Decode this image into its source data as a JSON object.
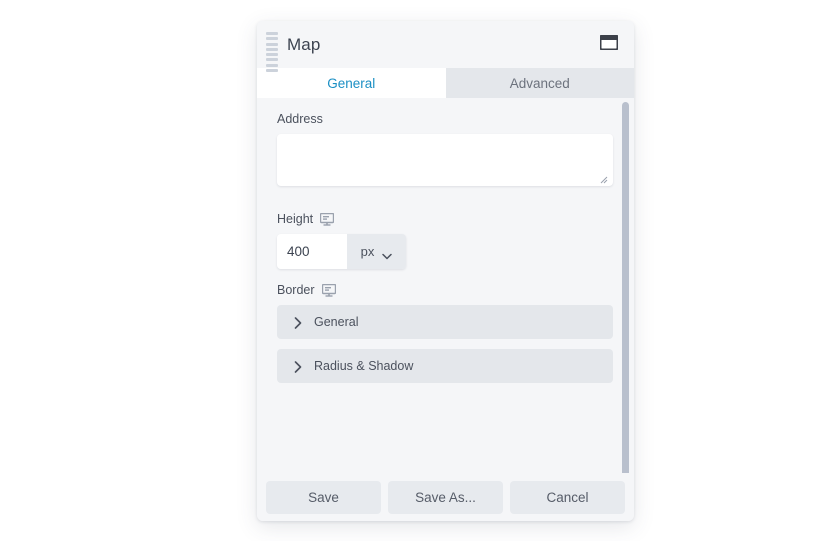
{
  "panel": {
    "title": "Map",
    "drag_handle_icon": "drag-handle-icon",
    "window_icon": "window-restore-icon",
    "drag_handle_bars": 8
  },
  "tabs": [
    {
      "label": "General",
      "active": true
    },
    {
      "label": "Advanced",
      "active": false
    }
  ],
  "form": {
    "address": {
      "label": "Address",
      "value": "",
      "placeholder": "",
      "resize_grip_icon": "resize-grip-icon"
    },
    "height": {
      "label": "Height",
      "responsive_icon": "desktop-monitor-icon",
      "value": "400",
      "placeholder": "",
      "unit": "px",
      "unit_chevron_icon": "chevron-down-icon"
    },
    "border": {
      "label": "Border",
      "responsive_icon": "desktop-monitor-icon",
      "sections": [
        {
          "label": "General",
          "chevron_icon": "chevron-right-icon",
          "expanded": false
        },
        {
          "label": "Radius & Shadow",
          "chevron_icon": "chevron-right-icon",
          "expanded": false
        }
      ]
    }
  },
  "footer": {
    "buttons": [
      {
        "label": "Save",
        "name": "save-button"
      },
      {
        "label": "Save As...",
        "name": "save-as-button"
      },
      {
        "label": "Cancel",
        "name": "cancel-button"
      }
    ]
  },
  "scrollbar": {
    "name": "vertical-scrollbar"
  },
  "colors": {
    "accent": "#1b8fc4",
    "panel_bg": "#f5f6f8",
    "tab_inactive_bg": "#e4e7eb",
    "control_bg": "#e7eaee",
    "text": "#4b515d",
    "scrollbar_thumb": "#b9c0cd"
  }
}
